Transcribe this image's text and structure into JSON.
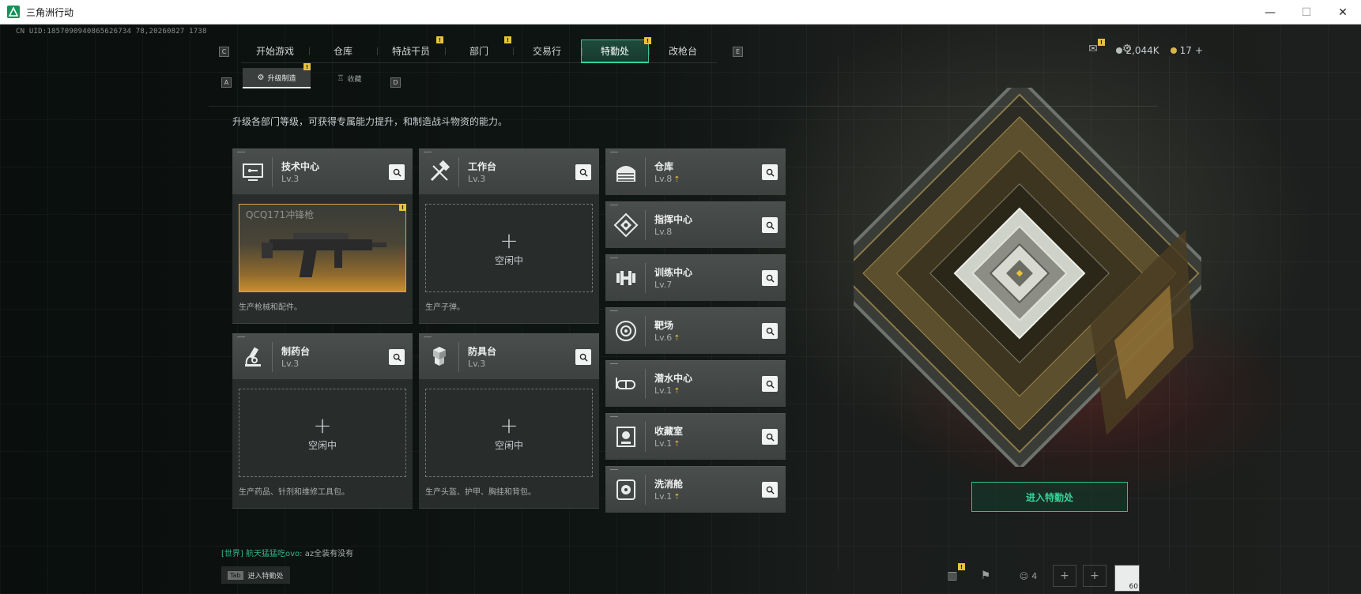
{
  "window": {
    "title": "三角洲行动",
    "controls": {
      "minimize": "—",
      "maximize": "☐",
      "close": "✕"
    }
  },
  "uid": "CN UID:1857090940865626734 78,20260827 1738",
  "nav": {
    "left_key": "C",
    "right_key": "E",
    "tabs": [
      {
        "label": "开始游戏",
        "badge": ""
      },
      {
        "label": "仓库",
        "badge": ""
      },
      {
        "label": "特战干员",
        "badge": "!"
      },
      {
        "label": "部门",
        "badge": "!"
      },
      {
        "label": "交易行",
        "badge": ""
      },
      {
        "label": "特勤处",
        "badge": "!",
        "active": true
      },
      {
        "label": "改枪台",
        "badge": ""
      }
    ]
  },
  "currency": {
    "money": "2,044K",
    "coupons": "17",
    "add": "+"
  },
  "subnav": {
    "left_key": "A",
    "right_key": "D",
    "tabs": [
      {
        "label": "升级制造",
        "icon": "⚙",
        "badge": "!",
        "active": true
      },
      {
        "label": "收藏",
        "icon": "♖",
        "badge": ""
      }
    ]
  },
  "intro": "升级各部门等级，可获得专属能力提升，和制造战斗物资的能力。",
  "workstations": [
    {
      "name": "技术中心",
      "level": "Lv.3",
      "desc": "生产枪械和配件。",
      "slot_item": "QCQ171冲锋枪",
      "slot_badge": "!"
    },
    {
      "name": "工作台",
      "level": "Lv.3",
      "desc": "生产子弹。",
      "slot_text": "空闲中"
    },
    {
      "name": "制药台",
      "level": "Lv.3",
      "desc": "生产药品、针剂和维修工具包。",
      "slot_text": "空闲中"
    },
    {
      "name": "防具台",
      "level": "Lv.3",
      "desc": "生产头盔、护甲、胸挂和背包。",
      "slot_text": "空闲中"
    }
  ],
  "facilities": [
    {
      "name": "仓库",
      "level": "Lv.8",
      "upgradable": true
    },
    {
      "name": "指挥中心",
      "level": "Lv.8",
      "upgradable": false
    },
    {
      "name": "训练中心",
      "level": "Lv.7",
      "upgradable": false
    },
    {
      "name": "靶场",
      "level": "Lv.6",
      "upgradable": true
    },
    {
      "name": "潜水中心",
      "level": "Lv.1",
      "upgradable": true
    },
    {
      "name": "收藏室",
      "level": "Lv.1",
      "upgradable": true
    },
    {
      "name": "洗消舱",
      "level": "Lv.1",
      "upgradable": true
    }
  ],
  "enter_button": "进入特勤处",
  "chat": {
    "channel": "[世界]",
    "user": "航天猛猛吃ovo:",
    "message": "az全装有没有"
  },
  "tab_hint": {
    "key": "Tab",
    "label": "进入特勤处"
  },
  "bottom_right": {
    "squad_count": "4",
    "avatar_level": "60",
    "stats_badge": "!"
  },
  "colors": {
    "accent": "#35d49a",
    "badge": "#e7c23d",
    "weapon_glow": "#c8902f"
  }
}
